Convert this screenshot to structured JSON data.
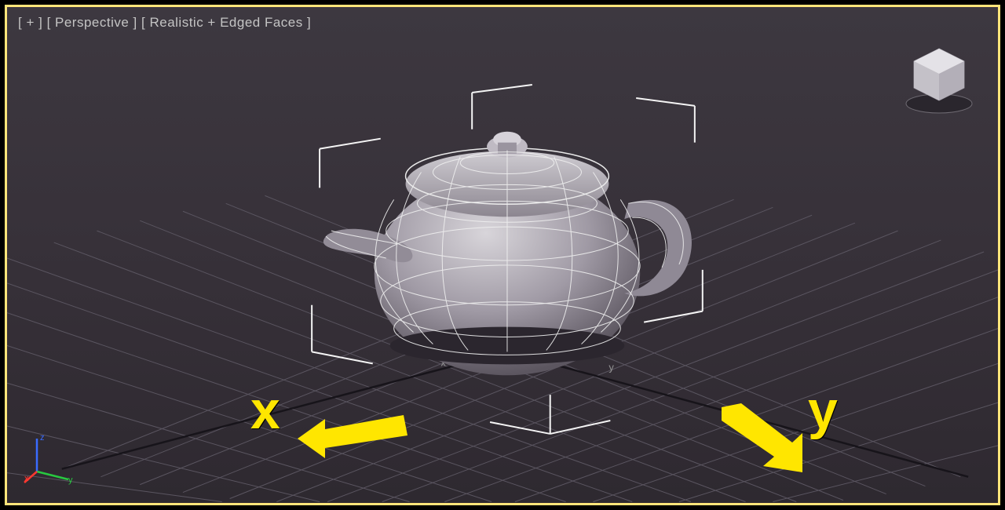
{
  "viewport": {
    "toggle": "[ + ]",
    "view": "[ Perspective ]",
    "shading": "[ Realistic + Edged Faces ]"
  },
  "scene": {
    "object": "Teapot",
    "axes": {
      "x": "x",
      "y": "y",
      "z": "z"
    },
    "annotation_x": "x",
    "annotation_y": "y"
  },
  "mini_axis": {
    "x": "x",
    "y": "y",
    "z": "z"
  },
  "viewcube": {
    "face": "  "
  }
}
